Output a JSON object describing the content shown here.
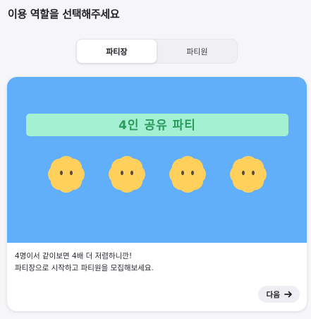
{
  "page": {
    "title": "이용 역할을 선택해주세요"
  },
  "role_tabs": [
    {
      "label": "파티장",
      "selected": true
    },
    {
      "label": "파티원",
      "selected": false
    }
  ],
  "card": {
    "hero": {
      "banner_text": "4인 공유 파티",
      "member_count": 4,
      "background_color": "#61aefa",
      "banner_color": "#a3f0d3",
      "banner_text_color": "#2b9a5c",
      "character_color": "#ffd15c",
      "character_icon": "flower-face-icon"
    },
    "description_lines": [
      "4명이서 같이보면 4배 더 저렴하니깐!",
      "파티장으로 시작하고 파티원을 모집해보세요."
    ],
    "next_button": {
      "label": "다음",
      "icon": "arrow-right-icon"
    }
  }
}
